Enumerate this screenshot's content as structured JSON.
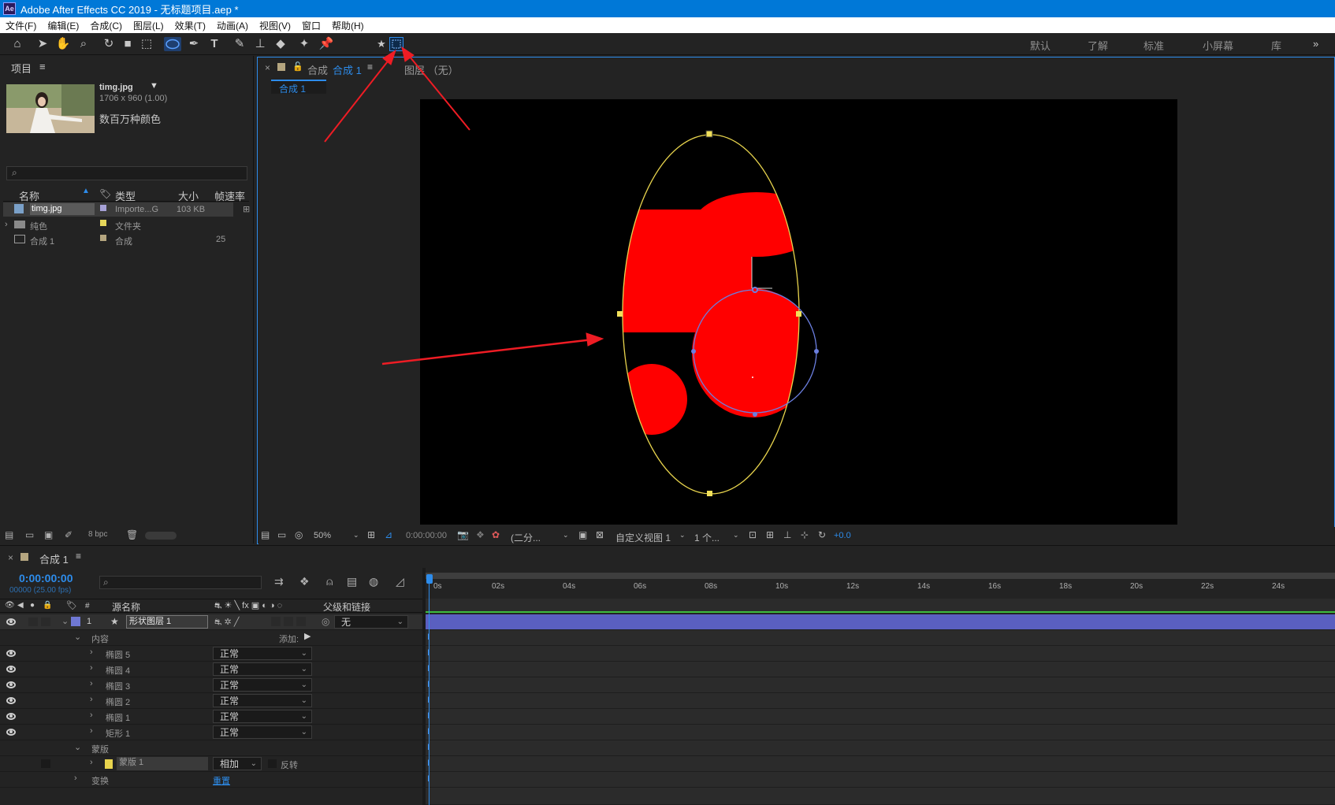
{
  "window": {
    "app_icon": "Ae",
    "title": "Adobe After Effects CC 2019 - 无标题项目.aep *"
  },
  "menu": [
    "文件(F)",
    "编辑(E)",
    "合成(C)",
    "图层(L)",
    "效果(T)",
    "动画(A)",
    "视图(V)",
    "窗口",
    "帮助(H)"
  ],
  "workspaces": [
    "默认",
    "了解",
    "标准",
    "小屏幕",
    "库"
  ],
  "project": {
    "title": "项目",
    "menu_icon": "≡",
    "asset_name": "timg.jpg",
    "asset_dims": "1706 x 960 (1.00)",
    "asset_color": "数百万种颜色",
    "search_icon": "⌕",
    "columns": {
      "name": "名称",
      "type": "类型",
      "size": "大小",
      "fps": "帧速率"
    },
    "rows": [
      {
        "name": "timg.jpg",
        "type": "Importe...G",
        "size": "103 KB",
        "fps": "",
        "color": "#a6a1d6"
      },
      {
        "name": "纯色",
        "type": "文件夹",
        "size": "",
        "fps": "",
        "color": "#e6d65a"
      },
      {
        "name": "合成 1",
        "type": "合成",
        "size": "",
        "fps": "25",
        "color": "#b5a680"
      }
    ],
    "bpc": "8 bpc"
  },
  "comp_panel": {
    "close": "×",
    "lock": "🔒",
    "label": "合成",
    "comp_name": "合成 1",
    "menu_icon": "≡",
    "layer_tab": "图层 （无）",
    "subtab": "合成 1"
  },
  "viewer_bar": {
    "zoom": "50%",
    "timecode": "0:00:00:00",
    "resolution": "(二分...",
    "view": "自定义视图 1",
    "views": "1 个...",
    "exposure": "+0.0"
  },
  "timeline": {
    "close": "×",
    "comp_name": "合成 1",
    "menu_icon": "≡",
    "timecode": "0:00:00:00",
    "frames": "00000 (25.00 fps)",
    "col_num": "#",
    "col_source": "源名称",
    "col_parent": "父级和链接",
    "layer": {
      "num": "1",
      "name": "形状图层 1",
      "parent": "无"
    },
    "contents_label": "内容",
    "add_label": "添加:",
    "items": [
      {
        "name": "椭圆 5",
        "mode": "正常"
      },
      {
        "name": "椭圆 4",
        "mode": "正常"
      },
      {
        "name": "椭圆 3",
        "mode": "正常"
      },
      {
        "name": "椭圆 2",
        "mode": "正常"
      },
      {
        "name": "椭圆 1",
        "mode": "正常"
      },
      {
        "name": "矩形 1",
        "mode": "正常"
      }
    ],
    "masks_label": "蒙版",
    "mask": {
      "name": "蒙版 1",
      "mode": "相加",
      "invert": "反转"
    },
    "transform_label": "变换",
    "reset_label": "重置",
    "ruler": [
      "0s",
      "02s",
      "04s",
      "06s",
      "08s",
      "10s",
      "12s",
      "14s",
      "16s",
      "18s",
      "20s",
      "22s",
      "24s"
    ]
  },
  "colors": {
    "accent": "#2d8ceb",
    "shape_fill": "#ff0000",
    "mask_path": "#e8d44d",
    "ellipse_path": "#6b7fe0",
    "layer_bar": "#6f78d4",
    "arrow": "#ee1c24"
  }
}
